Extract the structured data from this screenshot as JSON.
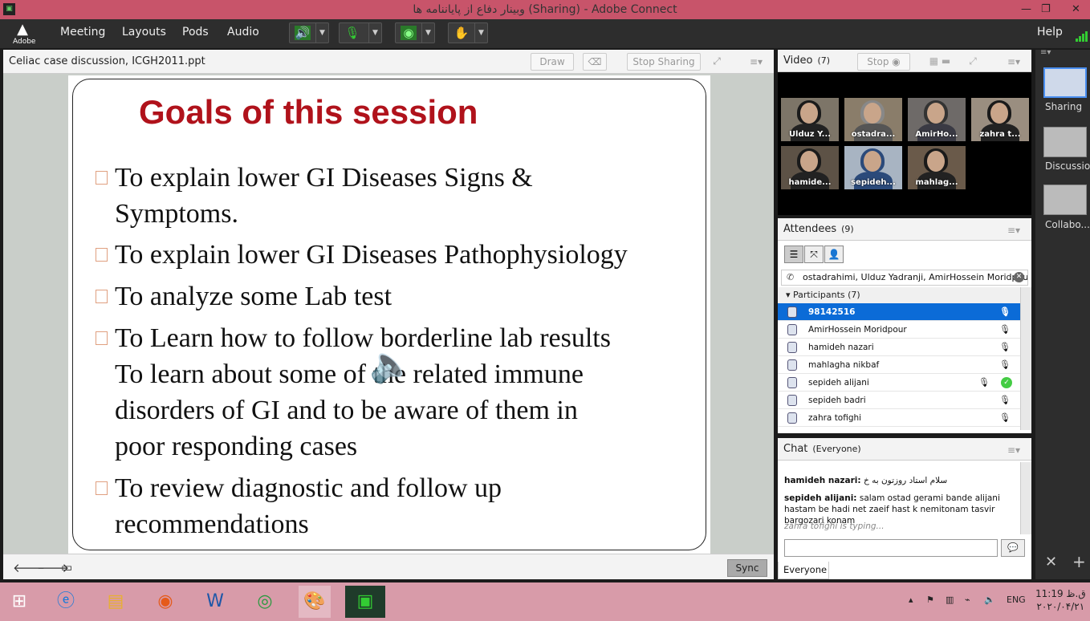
{
  "window": {
    "title": "وبینار دفاع از پایاننامه ها (Sharing) - Adobe Connect",
    "minimize": "—",
    "restore": "❐",
    "close": "✕"
  },
  "menubar": {
    "logo": "Adobe",
    "items": [
      "Meeting",
      "Layouts",
      "Pods",
      "Audio"
    ],
    "help": "Help",
    "accent": "#33cc33"
  },
  "share_pod": {
    "title": "Celiac case discussion, ICGH2011.ppt",
    "draw_label": "Draw",
    "stop_sharing_label": "Stop Sharing",
    "sync_label": "Sync",
    "slide": {
      "heading": "Goals of this session",
      "heading_color": "#b0121b",
      "bullets": [
        "To explain lower GI Diseases Signs &",
        "Symptoms.",
        "To explain lower GI Diseases Pathophysiology",
        "To analyze some Lab test",
        "To Learn how to follow borderline lab results",
        "To learn about some of the related immune",
        "disorders  of GI and to be aware of them in",
        "poor responding cases",
        "To review diagnostic and follow up",
        "recommendations"
      ]
    }
  },
  "video_pod": {
    "title": "Video",
    "count": "(7)",
    "stop_label": "Stop",
    "tiles": [
      "Ulduz Y...",
      "ostadra...",
      "AmirHo...",
      "zahra t...",
      "hamide...",
      "sepideh...",
      "mahlag..."
    ]
  },
  "attendees_pod": {
    "title": "Attendees",
    "count": "(9)",
    "filter_text": "ostadrahimi, Ulduz Yadranji, AmirHossein Moridpou...",
    "group_label": "Participants (7)",
    "participants": [
      "98142516",
      "AmirHossein Moridpour",
      "hamideh nazari",
      "mahlagha nikbaf",
      "sepideh alijani",
      "sepideh badri",
      "zahra tofighi"
    ],
    "selected_color": "#0b6bd7"
  },
  "chat_pod": {
    "title": "Chat",
    "audience": "(Everyone)",
    "messages": [
      {
        "sender": "hamideh nazari:",
        "text": "سلام استاد روزتون به خ"
      },
      {
        "sender": "sepideh alijani:",
        "text": "salam ostad gerami bande alijani hastam be hadi net zaeif hast k nemitonam tasvir bargozari konam"
      }
    ],
    "typing": "zahra tofighi is typing...",
    "tab": "Everyone"
  },
  "layouts_bar": {
    "items": [
      "Sharing",
      "Discussion",
      "Collabo..."
    ]
  },
  "taskbar": {
    "lang": "ENG",
    "time": "11:19 ق.ظ",
    "date": "۲۰۲۰/۰۴/۲۱"
  }
}
